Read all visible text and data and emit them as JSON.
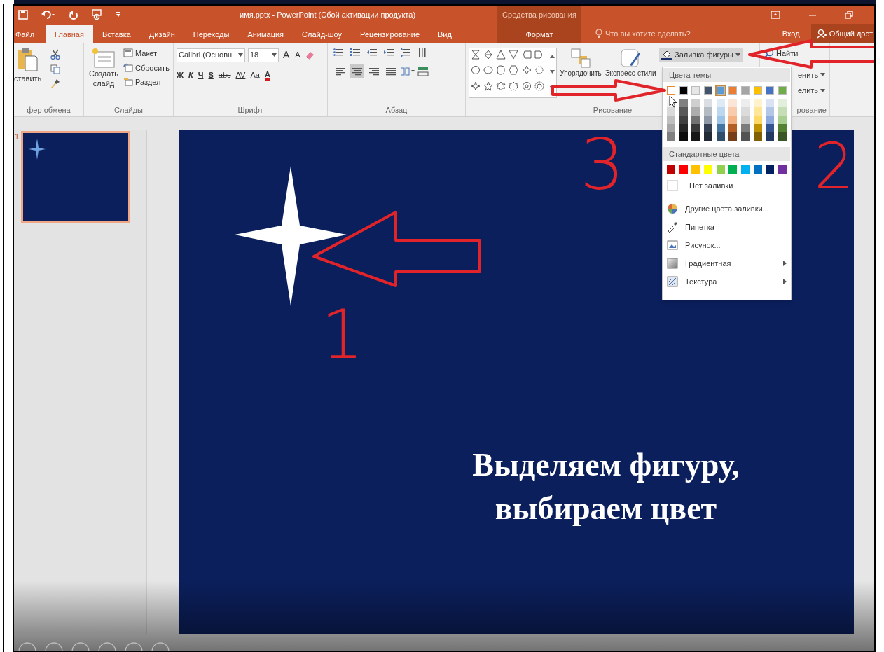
{
  "window": {
    "title": "имя.pptx - PowerPoint (Сбой активации продукта)",
    "context_header": "Средства рисования"
  },
  "tabs": [
    {
      "label": "Файл",
      "kind": "file",
      "selected": false
    },
    {
      "label": "Главная",
      "kind": "normal",
      "selected": true
    },
    {
      "label": "Вставка",
      "kind": "normal",
      "selected": false
    },
    {
      "label": "Дизайн",
      "kind": "normal",
      "selected": false
    },
    {
      "label": "Переходы",
      "kind": "normal",
      "selected": false
    },
    {
      "label": "Анимация",
      "kind": "normal",
      "selected": false
    },
    {
      "label": "Слайд-шоу",
      "kind": "normal",
      "selected": false
    },
    {
      "label": "Рецензирование",
      "kind": "normal",
      "selected": false
    },
    {
      "label": "Вид",
      "kind": "normal",
      "selected": false
    },
    {
      "label": "Формат",
      "kind": "contextual",
      "selected": false
    }
  ],
  "tell_me": "Что вы хотите сделать?",
  "sign_in": "Вход",
  "share": "Общий дост",
  "clipboard": {
    "paste": "ставить",
    "group_label": "фер обмена"
  },
  "slides_group": {
    "new_slide": "Создать слайд",
    "layout": "Макет",
    "reset": "Сбросить",
    "section": "Раздел",
    "group_label": "Слайды"
  },
  "font_group": {
    "font_name": "Calibri (Основн",
    "font_size": "18",
    "grow": "A",
    "shrink": "A",
    "styles": [
      "Ж",
      "К",
      "Ч",
      "S",
      "abc"
    ],
    "spacing": "AV",
    "change_case": "Aa",
    "font_color": "A",
    "group_label": "Шрифт"
  },
  "paragraph_group": {
    "alignment": [
      {
        "selected": false
      },
      {
        "selected": true
      },
      {
        "selected": false
      },
      {
        "selected": false
      }
    ],
    "group_label": "Абзац"
  },
  "drawing_group": {
    "arrange": "Упорядочить",
    "quick_styles": "Экспресс-стили",
    "shape_fill": "Заливка фигуры",
    "group_label": "Рисование"
  },
  "editing_group": {
    "find": "Найти",
    "replace": "енить",
    "select": "елить",
    "group_label": "рование"
  },
  "slides": [
    {
      "number": "1",
      "selected": true
    }
  ],
  "slide": {
    "lines": [
      "Выделяем фигуру,",
      "выбираем цвет"
    ]
  },
  "fill_menu": {
    "theme_header": "Цвета темы",
    "theme_colors": [
      {
        "color": "#ffffff",
        "hovered": true,
        "selected": false
      },
      {
        "color": "#000000",
        "hovered": false,
        "selected": false
      },
      {
        "color": "#e7e6e6",
        "hovered": false,
        "selected": false
      },
      {
        "color": "#44546a",
        "hovered": false,
        "selected": false
      },
      {
        "color": "#5b9bd5",
        "hovered": false,
        "selected": true
      },
      {
        "color": "#ed7d31",
        "hovered": false,
        "selected": false
      },
      {
        "color": "#a5a5a5",
        "hovered": false,
        "selected": false
      },
      {
        "color": "#ffc000",
        "hovered": false,
        "selected": false
      },
      {
        "color": "#4472c4",
        "hovered": false,
        "selected": false
      },
      {
        "color": "#70ad47",
        "hovered": false,
        "selected": false
      }
    ],
    "standard_header": "Стандартные цвета",
    "standard_colors": [
      {
        "color": "#c00000"
      },
      {
        "color": "#ff0000"
      },
      {
        "color": "#ffc000"
      },
      {
        "color": "#ffff00"
      },
      {
        "color": "#92d050"
      },
      {
        "color": "#00b050"
      },
      {
        "color": "#00b0f0"
      },
      {
        "color": "#0070c0"
      },
      {
        "color": "#002060"
      },
      {
        "color": "#7030a0"
      }
    ],
    "items": [
      {
        "label": "Нет заливки",
        "kind": "no_fill",
        "submenu": false
      },
      {
        "label": "Другие цвета заливки...",
        "kind": "more_colors",
        "submenu": false
      },
      {
        "label": "Пипетка",
        "kind": "eyedropper",
        "submenu": false
      },
      {
        "label": "Рисунок...",
        "kind": "picture",
        "submenu": false
      },
      {
        "label": "Градиентная",
        "kind": "gradient",
        "submenu": true
      },
      {
        "label": "Текстура",
        "kind": "texture",
        "submenu": true
      }
    ]
  },
  "annotations": [
    {
      "label": "1"
    },
    {
      "label": "2"
    },
    {
      "label": "3"
    }
  ]
}
